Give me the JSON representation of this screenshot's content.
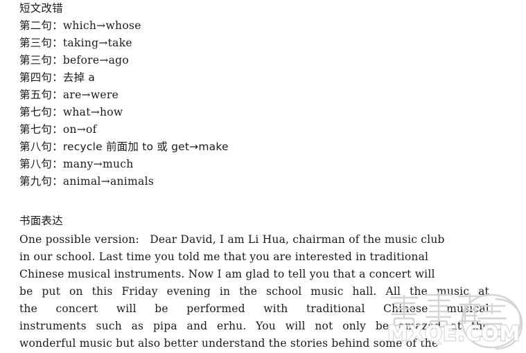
{
  "document": {
    "background_color": "#ffffff",
    "text_color": "#1a1a1a"
  },
  "corrections_section": {
    "heading": "短文改错",
    "items": [
      {
        "label": "第二句：",
        "change": "which→whose"
      },
      {
        "label": "第三句：",
        "change": "taking→take"
      },
      {
        "label": "第三句：",
        "change": "before→ago"
      },
      {
        "label": "第四句：",
        "change": "去掉 a"
      },
      {
        "label": "第五句：",
        "change": "are→were"
      },
      {
        "label": "第七句：",
        "change": "what→how"
      },
      {
        "label": "第七句：",
        "change": "on→of"
      },
      {
        "label": "第八句：",
        "change": "recycle 前面加 to 或 get→make"
      },
      {
        "label": "第八句：",
        "change": "many→much"
      },
      {
        "label": "第九句：",
        "change": "animal→animals"
      }
    ]
  },
  "essay_section": {
    "heading": "书面表达",
    "lines": [
      {
        "justified": false,
        "text": "One possible version:   Dear David, I am Li Hua, chairman of the music club"
      },
      {
        "justified": false,
        "text": "in our school. Last time you told me that you are interested in traditional"
      },
      {
        "justified": false,
        "text": "Chinese musical instruments. Now I am glad to tell you that a concert will"
      },
      {
        "justified": true,
        "words": [
          "be",
          "put",
          "on",
          "this",
          "Friday",
          "evening",
          "in",
          "the",
          "school",
          "music",
          "hall.",
          "All",
          "the",
          "music",
          "at"
        ]
      },
      {
        "justified": true,
        "words": [
          "the",
          "concert",
          "will",
          "be",
          "performed",
          "with",
          "traditional",
          "Chinese",
          "musical"
        ]
      },
      {
        "justified": true,
        "words": [
          "instruments",
          "such",
          "as",
          "pipa",
          "and",
          "erhu.",
          "You",
          "will",
          "not",
          "only",
          "be",
          "amazed",
          "at",
          "the"
        ]
      },
      {
        "justified": false,
        "text": "wonderful music but also better understand the stories behind some of the"
      }
    ]
  },
  "watermark": {
    "site_text": "MXQE.COM",
    "chinese_text": "答案圈",
    "stroke_color": "#d2d2d2",
    "fill_color": "#ffffff"
  }
}
